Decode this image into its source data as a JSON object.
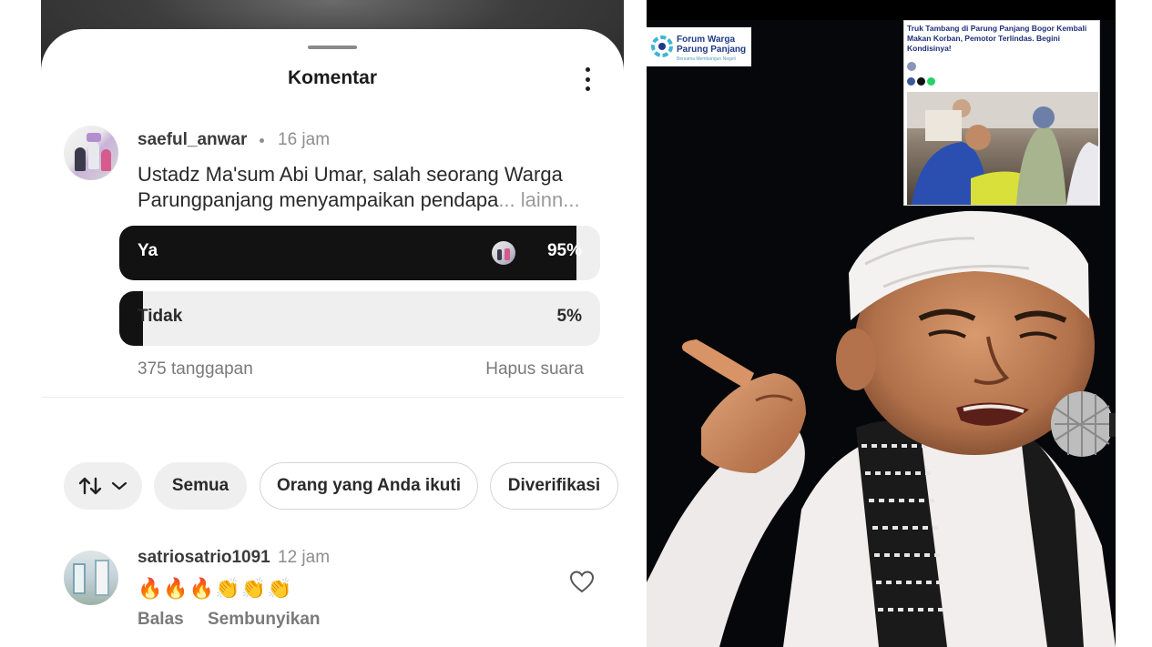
{
  "comments_panel": {
    "title": "Komentar",
    "post": {
      "username": "saeful_anwar",
      "time": "16 jam",
      "text": "Ustadz Ma'sum Abi Umar, salah seorang Warga Parungpanjang menyampaikan pendapa",
      "more": "... lainn..."
    },
    "poll": {
      "options": [
        {
          "label": "Ya",
          "percent_text": "95%",
          "share": 0.95
        },
        {
          "label": "Tidak",
          "percent_text": "5%",
          "share": 0.05
        }
      ],
      "responses": "375 tanggapan",
      "remove_vote": "Hapus suara"
    },
    "filters": {
      "sort_icon": "sort-arrows-icon",
      "all": "Semua",
      "following": "Orang yang Anda ikuti",
      "verified": "Diverifikasi"
    },
    "comment": {
      "username": "satriosatrio1091",
      "time": "12 jam",
      "text": "🔥🔥🔥👏👏👏",
      "reply": "Balas",
      "hide": "Sembunyikan"
    }
  },
  "image_panel": {
    "logo": {
      "line1": "Forum Warga",
      "line2": "Parung Panjang",
      "tagline": "Bersama Membangun Negeri"
    },
    "news_card": {
      "headline": "Truk Tambang di Parung Panjang Bogor Kembali Makan Korban, Pemotor Terlindas. Begini Kondisinya!"
    }
  },
  "colors": {
    "poll_fill": "#121212",
    "poll_track": "#efefef",
    "muted_text": "#7a7a7a",
    "logo_blue": "#1f3a86"
  }
}
